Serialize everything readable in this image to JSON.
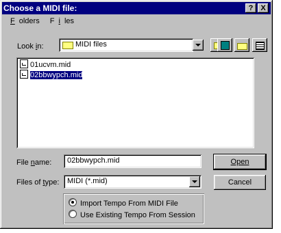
{
  "window": {
    "title": "Choose a MIDI file:",
    "help_label": "?",
    "close_label": "X"
  },
  "menu": [
    {
      "label": "Folders",
      "key": "F"
    },
    {
      "label": "Files",
      "key": "i"
    }
  ],
  "lookin": {
    "label": "Look in:",
    "value": "MIDI files"
  },
  "files": [
    {
      "name": "01ucvm.mid",
      "selected": false
    },
    {
      "name": "02bbwypch.mid",
      "selected": true
    }
  ],
  "filename": {
    "label": "File name:",
    "value": "02bbwypch.mid"
  },
  "filetype": {
    "label": "Files of type:",
    "value": "MIDI (*.mid)"
  },
  "buttons": {
    "open": "Open",
    "cancel": "Cancel"
  },
  "tempo_options": [
    {
      "label": "Import Tempo From MIDI File",
      "selected": true
    },
    {
      "label": "Use Existing Tempo From Session",
      "selected": false
    }
  ],
  "colors": {
    "titlebar": "#000080",
    "face": "#c0c0c0",
    "selection": "#000080"
  }
}
